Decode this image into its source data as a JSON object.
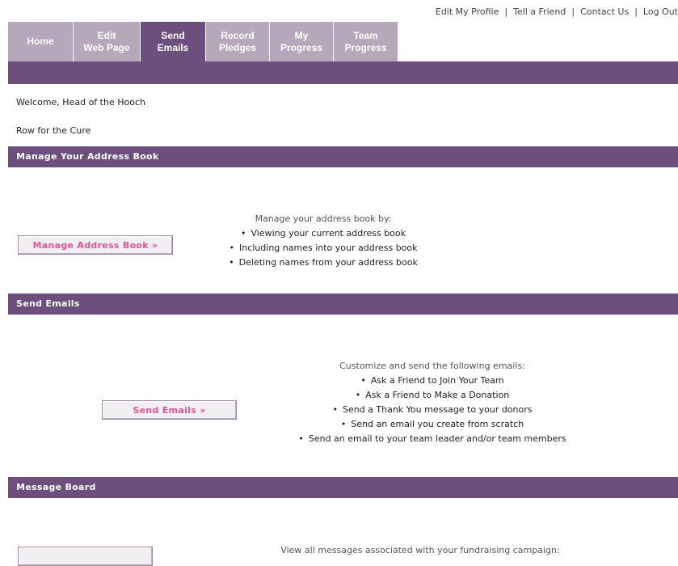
{
  "top_links": [
    "Edit My Profile",
    "Tell a Friend",
    "Contact Us",
    "Log Out"
  ],
  "tabs": [
    {
      "label": "Home",
      "active": false
    },
    {
      "label": "Edit\nWeb Page",
      "active": false
    },
    {
      "label": "Send\nEmails",
      "active": true
    },
    {
      "label": "Record\nPledges",
      "active": false
    },
    {
      "label": "My\nProgress",
      "active": false
    },
    {
      "label": "Team\nProgress",
      "active": false
    }
  ],
  "welcome": "Welcome, Head of the Hooch",
  "campaign": "Row for the Cure",
  "sections": {
    "address_book": {
      "title": "Manage Your Address Book",
      "button": "Manage Address Book »",
      "intro": "Manage your address book by:",
      "items": [
        "Viewing your current address book",
        "Including names into your address book",
        "Deleting names from your address book"
      ]
    },
    "send_emails": {
      "title": "Send Emails",
      "button": "Send Emails »",
      "intro": "Customize and send the following emails:",
      "items": [
        "Ask a Friend to Join Your Team",
        "Ask a Friend to Make a Donation",
        "Send a Thank You message to your donors",
        "Send an email you create from scratch",
        "Send an email to your team leader and/or team members"
      ]
    },
    "message_board": {
      "title": "Message Board",
      "intro": "View all messages associated with your fundraising campaign:"
    }
  },
  "colors": {
    "tab_active": "#6c4f7c",
    "tab_inactive": "#b7a7bb",
    "section_bar": "#6c4f7c",
    "button_text": "#e0559a"
  }
}
